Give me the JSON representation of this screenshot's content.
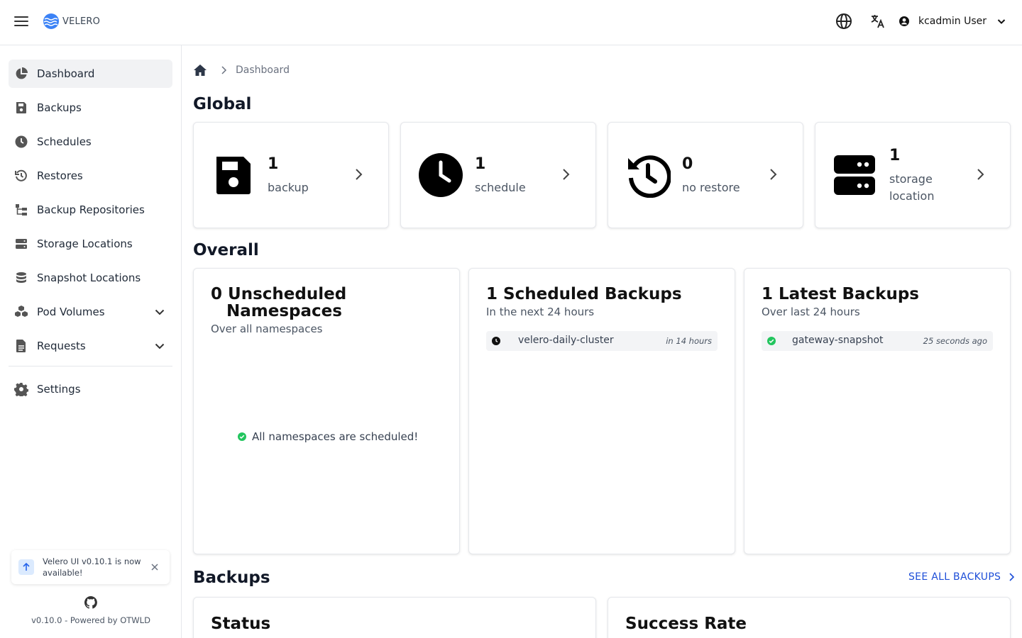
{
  "header": {
    "logo_text": "VELERO",
    "user_name": "kcadmin User",
    "icons": [
      "menu-icon",
      "globe-icon",
      "translate-icon",
      "user-circle-icon",
      "chevron-down-icon"
    ]
  },
  "sidebar": {
    "items": [
      {
        "label": "Dashboard",
        "icon": "chart-pie-icon",
        "active": true
      },
      {
        "label": "Backups",
        "icon": "floppy-disk-icon"
      },
      {
        "label": "Schedules",
        "icon": "clock-icon"
      },
      {
        "label": "Restores",
        "icon": "history-icon"
      },
      {
        "label": "Backup Repositories",
        "icon": "tree-icon"
      },
      {
        "label": "Storage Locations",
        "icon": "server-icon"
      },
      {
        "label": "Snapshot Locations",
        "icon": "database-icon"
      },
      {
        "label": "Pod Volumes",
        "icon": "cubes-icon",
        "expandable": true
      },
      {
        "label": "Requests",
        "icon": "file-icon",
        "expandable": true
      },
      {
        "label": "Settings",
        "icon": "gear-icon"
      }
    ],
    "update_notice": "Velero UI v0.10.1 is now available!",
    "footer": "v0.10.0 - Powered by OTWLD"
  },
  "breadcrumb": {
    "current": "Dashboard"
  },
  "global": {
    "title": "Global",
    "cards": [
      {
        "count": "1",
        "label": "backup",
        "icon": "floppy-disk-icon"
      },
      {
        "count": "1",
        "label": "schedule",
        "icon": "clock-icon"
      },
      {
        "count": "0",
        "label": "no restore",
        "icon": "history-icon"
      },
      {
        "count": "1",
        "label": "storage location",
        "icon": "server-icon"
      }
    ]
  },
  "overall": {
    "title": "Overall",
    "unscheduled": {
      "count": "0",
      "title_line1": "Unscheduled",
      "title_line2": "Namespaces",
      "subtitle": "Over all namespaces",
      "message": "All namespaces are scheduled!"
    },
    "scheduled": {
      "count": "1",
      "title": "Scheduled Backups",
      "subtitle": "In the next 24 hours",
      "rows": [
        {
          "name": "velero-daily-cluster",
          "time": "in 14 hours"
        }
      ]
    },
    "latest": {
      "count": "1",
      "title": "Latest Backups",
      "subtitle": "Over last 24 hours",
      "rows": [
        {
          "name": "gateway-snapshot",
          "time": "25 seconds ago"
        }
      ]
    }
  },
  "backups": {
    "title": "Backups",
    "see_all": "SEE ALL BACKUPS",
    "status_title": "Status",
    "success_rate_title": "Success Rate"
  },
  "colors": {
    "accent": "#1d4ed8",
    "success": "#22c55e",
    "logo": "#3b82f6"
  }
}
